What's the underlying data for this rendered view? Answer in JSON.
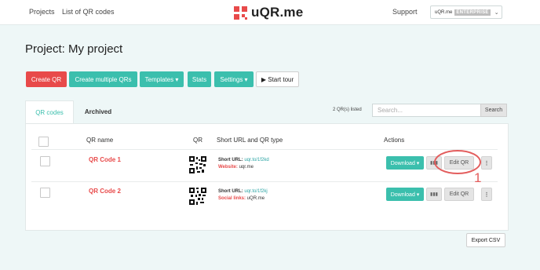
{
  "header": {
    "nav": [
      "Projects",
      "List of QR codes"
    ],
    "logo_text": "uQR.me",
    "support_label": "Support",
    "account": {
      "name": "uQR.me",
      "plan": "ENTERPRISE"
    }
  },
  "page": {
    "title": "Project: My project"
  },
  "toolbar": {
    "create_qr": "Create QR",
    "create_multiple": "Create multiple QRs",
    "templates": "Templates ▾",
    "stats": "Stats",
    "settings": "Settings ▾",
    "start_tour": "▶ Start tour"
  },
  "tabs": {
    "active": "QR codes",
    "archived": "Archived"
  },
  "listing": {
    "count_text": "2 QR(s) listed",
    "search_placeholder": "Search...",
    "search_button": "Search"
  },
  "table": {
    "headers": {
      "name": "QR name",
      "qr": "QR",
      "short_url": "Short URL and QR type",
      "actions": "Actions"
    },
    "rows": [
      {
        "name": "QR Code 1",
        "short_label": "Short URL:",
        "short_url": "uqr.to/1f2kd",
        "type_label": "Website:",
        "type_value": "uqr.me"
      },
      {
        "name": "QR Code 2",
        "short_label": "Short URL:",
        "short_url": "uqr.to/1f2kj",
        "type_label": "Social links:",
        "type_value": "uQR.me"
      }
    ],
    "actions": {
      "download": "Download ▾",
      "edit": "Edit QR",
      "more": "⋮"
    }
  },
  "annotation": {
    "marker": "1"
  },
  "footer": {
    "export": "Export CSV"
  },
  "colors": {
    "accent": "#3bbfad",
    "brand_red": "#e84a4a",
    "background": "#eef7f7"
  },
  "icons": {
    "stats_icon": "bar-chart-icon",
    "more_icon": "vertical-dots-icon",
    "chevron": "chevron-down-icon"
  }
}
